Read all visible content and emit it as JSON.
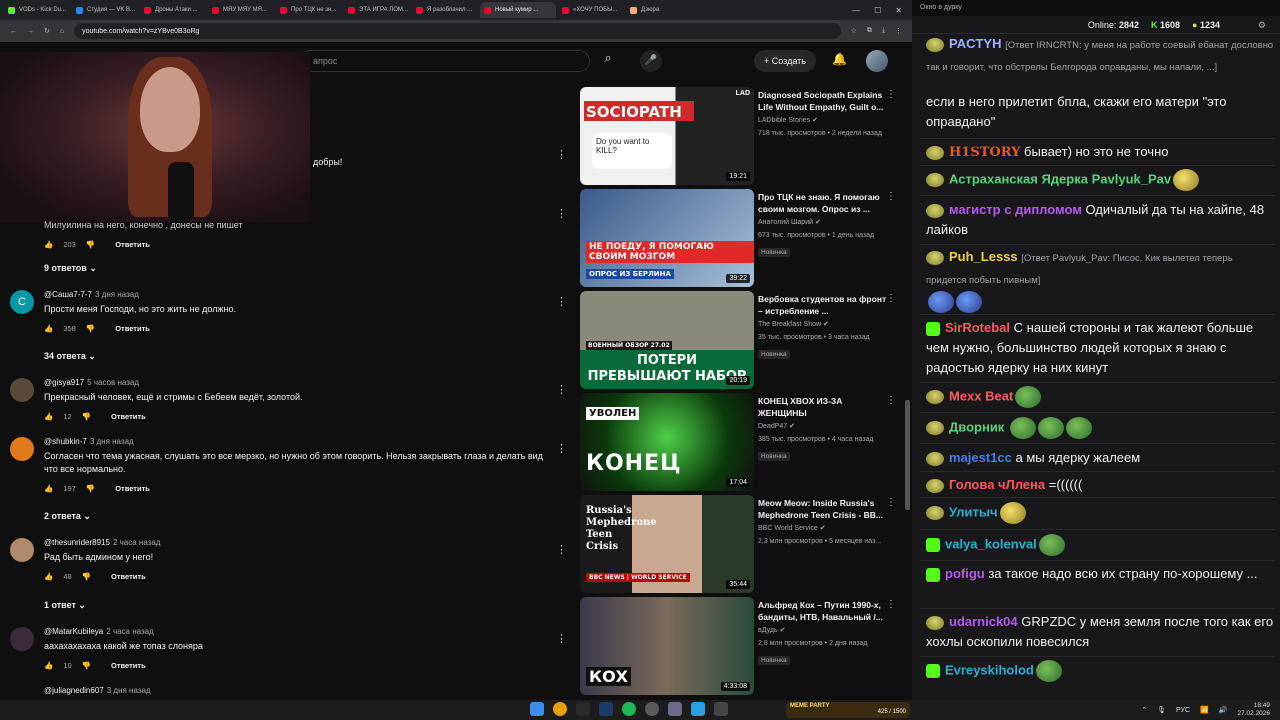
{
  "browser": {
    "tabs": [
      "VODs - Kick Du...",
      "Студия — VK В...",
      "Дроны Атаки ...",
      "МЯУ МЯУ МЯ...",
      "Про ТЦК не зн...",
      "ЭТА ИГРА ЛОМ...",
      "Я разоблачил ...",
      "Новый кумир ...",
      "«ХОЧУ ПОБЫ...",
      "Дзюра"
    ],
    "active_tab": 7,
    "url": "youtube.com/watch?v=zYBve0B3oRg"
  },
  "yt": {
    "search_placeholder": "апрос",
    "create_label": "Создать",
    "partial_text": "добры!"
  },
  "comments": [
    {
      "text": "Милуилина на него, конечно , донесы не пишет",
      "likes": "203",
      "reply": "Ответить",
      "replies": "9 ответов"
    },
    {
      "author": "@Саша7-7-7",
      "time": "3 дня назад",
      "text": "Прости меня Господи, но это жить не должно.",
      "likes": "358",
      "reply": "Ответить",
      "replies": "34 ответа",
      "avatar": "С"
    },
    {
      "author": "@gisya917",
      "time": "5 часов назад",
      "text": "Прекрасный человек, ещё и стримы с Бебеем ведёт, золотой.",
      "likes": "12",
      "reply": "Ответить"
    },
    {
      "author": "@shubkin-7",
      "time": "3 дня назад",
      "text": "Согласен что тема ужасная, слушать это все мерзко, но нужно об этом говорить. Нельзя закрывать глаза и делать вид что все нормально.",
      "likes": "197",
      "reply": "Ответить",
      "replies": "2 ответа"
    },
    {
      "author": "@thesunrider8915",
      "time": "2 часа назад",
      "text": "Рад быть админом у него!",
      "likes": "48",
      "reply": "Ответить",
      "replies": "1 ответ"
    },
    {
      "author": "@MatarKubileya",
      "time": "2 часа назад",
      "text": "аахахахахаха какой же топаз слоняра",
      "likes": "10",
      "reply": "Ответить"
    },
    {
      "author": "@juliagnedin607",
      "time": "3 дня назад"
    }
  ],
  "videos": [
    {
      "title": "Diagnosed Sociopath Explains Life Without Empathy, Guilt o...",
      "channel": "LADbible Stories",
      "meta": "718 тыс. просмотров • 2 недели назад",
      "duration": "19:21",
      "thumb_text": "SOCIOPATH",
      "thumb_sub": "Do you want to KILL?",
      "thumb_logo": "LAD"
    },
    {
      "title": "Про ТЦК не знаю. Я помогаю своим мозгом. Опрос из ...",
      "channel": "Анатолий Шарий",
      "meta": "673 тыс. просмотров • 1 день назад",
      "badge": "Новинка",
      "duration": "39:22",
      "thumb_text": "НЕ ПОЕДУ, Я ПОМОГАЮ СВОИМ МОЗГОМ",
      "thumb_sub": "ОПРОС ИЗ БЕРЛИНА"
    },
    {
      "title": "Вербовка студентов на фронт – истребление ...",
      "channel": "The Breakfast Show",
      "meta": "35 тыс. просмотров • 3 часа назад",
      "badge": "Новинка",
      "duration": "20:19",
      "thumb_text": "ПОТЕРИ ПРЕВЫШАЮТ НАБОР",
      "thumb_sub": "ВОЕННЫЙ ОБЗОР  27.02"
    },
    {
      "title": "КОНЕЦ XBOX ИЗ-ЗА ЖЕНЩИНЫ",
      "channel": "DeadP47",
      "meta": "385 тыс. просмотров • 4 часа назад",
      "badge": "Новинка",
      "duration": "17:04",
      "thumb_text": "КОНЕЦ",
      "thumb_sub": "УВОЛЕН"
    },
    {
      "title": "Meow Meow: Inside Russia's Mephedrone Teen Crisis - BB...",
      "channel": "BBC World Service",
      "meta": "2,3 млн просмотров • 5 месяцев наз...",
      "duration": "35:44",
      "thumb_text": "Russia's Mephedrone Teen Crisis",
      "thumb_sub": "BBC NEWS | WORLD SERVICE"
    },
    {
      "title": "Альфред Кох – Путин 1990-х, бандиты, НТВ, Навальный /...",
      "channel": "вДудь",
      "meta": "2,8 млн просмотров • 2 дня назад",
      "badge": "Новинка",
      "duration": "4:33:08",
      "thumb_text": "КОХ"
    }
  ],
  "chat": {
    "window_title": "Окно в дурку",
    "online_label": "Online:",
    "online_count": "2842",
    "kick_count": "1608",
    "other_count": "1234",
    "messages": [
      {
        "nick": "PACTYH",
        "reply": "[Ответ IRNCRTN: у меня на работе соевый ебанат дословно так и говорит, что обстрелы Белгорода оправданы, мы напали, ...]",
        "color": "#9bb1ff"
      },
      {
        "text": "если в него прилетит бпла, скажи его матери \"это оправдано\""
      },
      {
        "nick": "H1STORY",
        "text": "бывает) но это не точно",
        "color": "#e05a2a"
      },
      {
        "nick": "Астраханская Ядерка",
        "text": "Pavlyuk_Pav",
        "color": "#5ad37a"
      },
      {
        "nick": "магистр с дипломом",
        "text": "Одичалый да ты на хайпе, 48 лайков",
        "color": "#b45af0"
      },
      {
        "nick": "Puh_Lesss",
        "reply": "[Ответ Pavlyuk_Pav: Писос. Кик вылетел теперь придется побыть пивным]",
        "color": "#f0d24a"
      },
      {
        "nick": "SirRotebal",
        "text": "С нашей стороны и так жалеют больше чем нужно, большинство людей которых я знаю с радостью ядерку на них кинут",
        "color": "#ff5a5a"
      },
      {
        "nick": "Mexx Beat",
        "color": "#ff5a5a"
      },
      {
        "nick": "Дворник",
        "color": "#5ad37a"
      },
      {
        "nick": "majest1cc",
        "text": "а мы ядерку жалеем",
        "color": "#4a7af0"
      },
      {
        "nick": "Голова чЛлена",
        "text": "=((((((",
        "color": "#ff5a5a"
      },
      {
        "nick": "Улитыч",
        "color": "#2ab0d0"
      },
      {
        "nick": "valya_kolenval",
        "color": "#2ab0d0"
      },
      {
        "nick": "pofigu",
        "text": "за такое надо всю их страну по-хорошему ...",
        "color": "#b45af0"
      },
      {
        "nick": "udarnick04",
        "text": "GRPZDC у меня земля после того как его хохлы оскопили повесился",
        "color": "#b45af0"
      },
      {
        "nick": "Evreyskiholod",
        "color": "#2ab0d0"
      }
    ]
  },
  "taskbar": {
    "widget_title": "MEME PARTY",
    "widget_text": "425 / 1500",
    "lang": "РУС",
    "time": "18:49",
    "date": "27.02.2026"
  }
}
